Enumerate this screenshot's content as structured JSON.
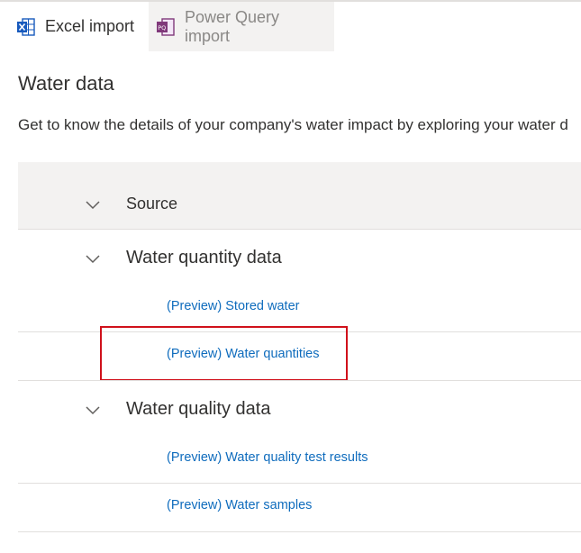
{
  "tabs": [
    {
      "label": "Excel import",
      "icon": "excel-icon",
      "state": "active"
    },
    {
      "label": "Power Query import",
      "icon": "power-query-icon",
      "state": "inactive"
    }
  ],
  "page": {
    "title": "Water data",
    "description": "Get to know the details of your company's water impact by exploring your water d"
  },
  "table": {
    "header_label": "Source",
    "groups": [
      {
        "label": "Water quantity data",
        "items": [
          "(Preview) Stored water",
          "(Preview) Water quantities"
        ]
      },
      {
        "label": "Water quality data",
        "items": [
          "(Preview) Water quality test results",
          "(Preview) Water samples"
        ]
      }
    ]
  },
  "colors": {
    "link": "#0f6cbd",
    "highlight_border": "#d0111b",
    "header_background": "#f3f2f1"
  }
}
